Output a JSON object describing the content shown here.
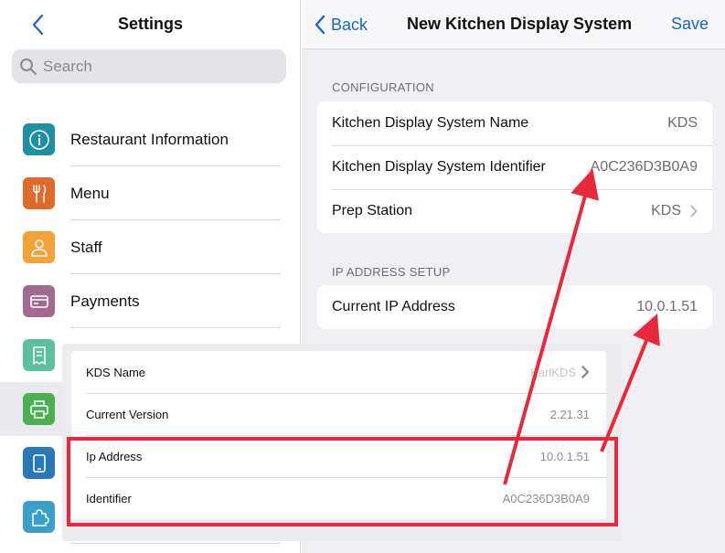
{
  "left": {
    "title": "Settings",
    "search_placeholder": "Search",
    "items": [
      {
        "label": "Restaurant Information",
        "icon": "info-icon",
        "color": "#1f8fa3"
      },
      {
        "label": "Menu",
        "icon": "fork-knife-icon",
        "color": "#e06a2c"
      },
      {
        "label": "Staff",
        "icon": "person-icon",
        "color": "#f5a13a"
      },
      {
        "label": "Payments",
        "icon": "card-icon",
        "color": "#a06b8c"
      },
      {
        "label": "",
        "icon": "receipt-icon",
        "color": "#5bbfa0"
      },
      {
        "label": "",
        "icon": "printer-icon",
        "color": "#4caf50"
      },
      {
        "label": "",
        "icon": "tablet-icon",
        "color": "#2a79b6"
      },
      {
        "label": "",
        "icon": "puzzle-icon",
        "color": "#3ba0c9"
      }
    ]
  },
  "nav": {
    "back_label": "Back",
    "title": "New Kitchen Display System",
    "save_label": "Save"
  },
  "configuration": {
    "header": "CONFIGURATION",
    "rows": [
      {
        "key": "Kitchen Display System Name",
        "value": "KDS"
      },
      {
        "key": "Kitchen Display System Identifier",
        "value": "A0C236D3B0A9"
      },
      {
        "key": "Prep Station",
        "value": "KDS"
      }
    ]
  },
  "ip_setup": {
    "header": "IP ADDRESS SETUP",
    "rows": [
      {
        "key": "Current IP Address",
        "value": "10.0.1.51"
      }
    ]
  },
  "overlay": {
    "rows": [
      {
        "key": "KDS Name",
        "value": "KarlKDS"
      },
      {
        "key": "Current Version",
        "value": "2.21.31"
      },
      {
        "key": "Ip Address",
        "value": "10.0.1.51"
      },
      {
        "key": "Identifier",
        "value": "A0C236D3B0A9"
      }
    ]
  },
  "colors": {
    "accent": "#1666c9",
    "annotation": "#e8283b"
  }
}
